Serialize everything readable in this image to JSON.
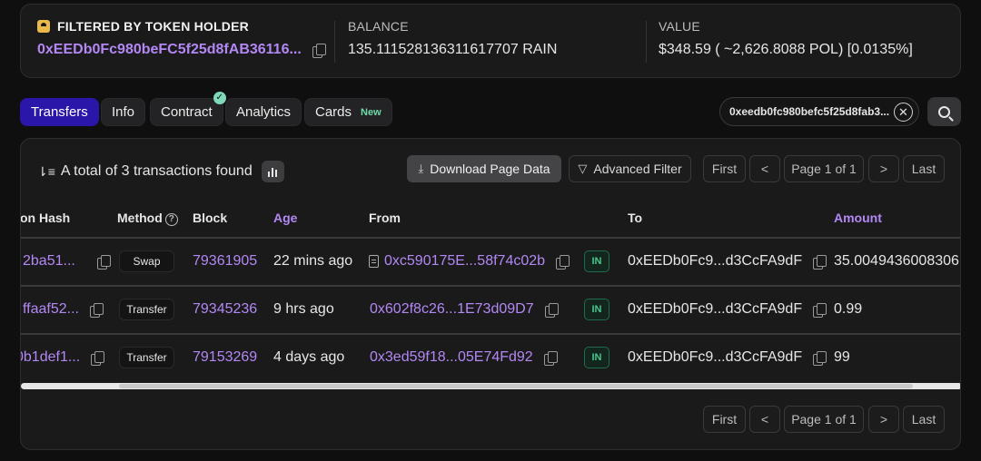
{
  "summary": {
    "holder_label": "FILTERED BY TOKEN HOLDER",
    "holder_address": "0xEEDb0Fc980beFC5f25d8fAB36116...",
    "balance_label": "BALANCE",
    "balance_value": "135.111528136311617707 RAIN",
    "value_label": "VALUE",
    "value_value": "$348.59 ( ~2,626.8088 POL) [0.0135%]"
  },
  "tabs": [
    {
      "label": "Transfers"
    },
    {
      "label": "Info"
    },
    {
      "label": "Contract"
    },
    {
      "label": "Analytics"
    },
    {
      "label": "Cards",
      "badge": "New"
    }
  ],
  "search": {
    "value": "0xeedb0fc980befc5f25d8fab3..."
  },
  "toolbar": {
    "total_text": "A total of 3 transactions found",
    "download_label": "Download Page Data",
    "filter_label": "Advanced Filter"
  },
  "pagination": {
    "first": "First",
    "prev": "<",
    "page_text": "Page 1 of 1",
    "next": ">",
    "last": "Last"
  },
  "table": {
    "headers": {
      "hash": "on Hash",
      "method": "Method",
      "block": "Block",
      "age": "Age",
      "from": "From",
      "to": "To",
      "amount": "Amount"
    },
    "rows": [
      {
        "hash": "2ba51...",
        "method": "Swap",
        "block": "79361905",
        "age": "22 mins ago",
        "from": "0xc590175E...58f74c02b",
        "dir": "IN",
        "to": "0xEEDb0Fc9...d3CcFA9dF",
        "amount": "35.0049436008306"
      },
      {
        "hash": "ffaaf52...",
        "method": "Transfer",
        "block": "79345236",
        "age": "9 hrs ago",
        "from": "0x602f8c26...1E73d09D7",
        "dir": "IN",
        "to": "0xEEDb0Fc9...d3CcFA9dF",
        "amount": "0.99"
      },
      {
        "hash": "0b1def1...",
        "method": "Transfer",
        "block": "79153269",
        "age": "4 days ago",
        "from": "0x3ed59f18...05E74Fd92",
        "dir": "IN",
        "to": "0xEEDb0Fc9...d3CcFA9dF",
        "amount": "99"
      }
    ]
  },
  "colors": {
    "accent": "#b388f4",
    "active_tab": "#2a16a8",
    "in_badge": "#47c68c"
  }
}
